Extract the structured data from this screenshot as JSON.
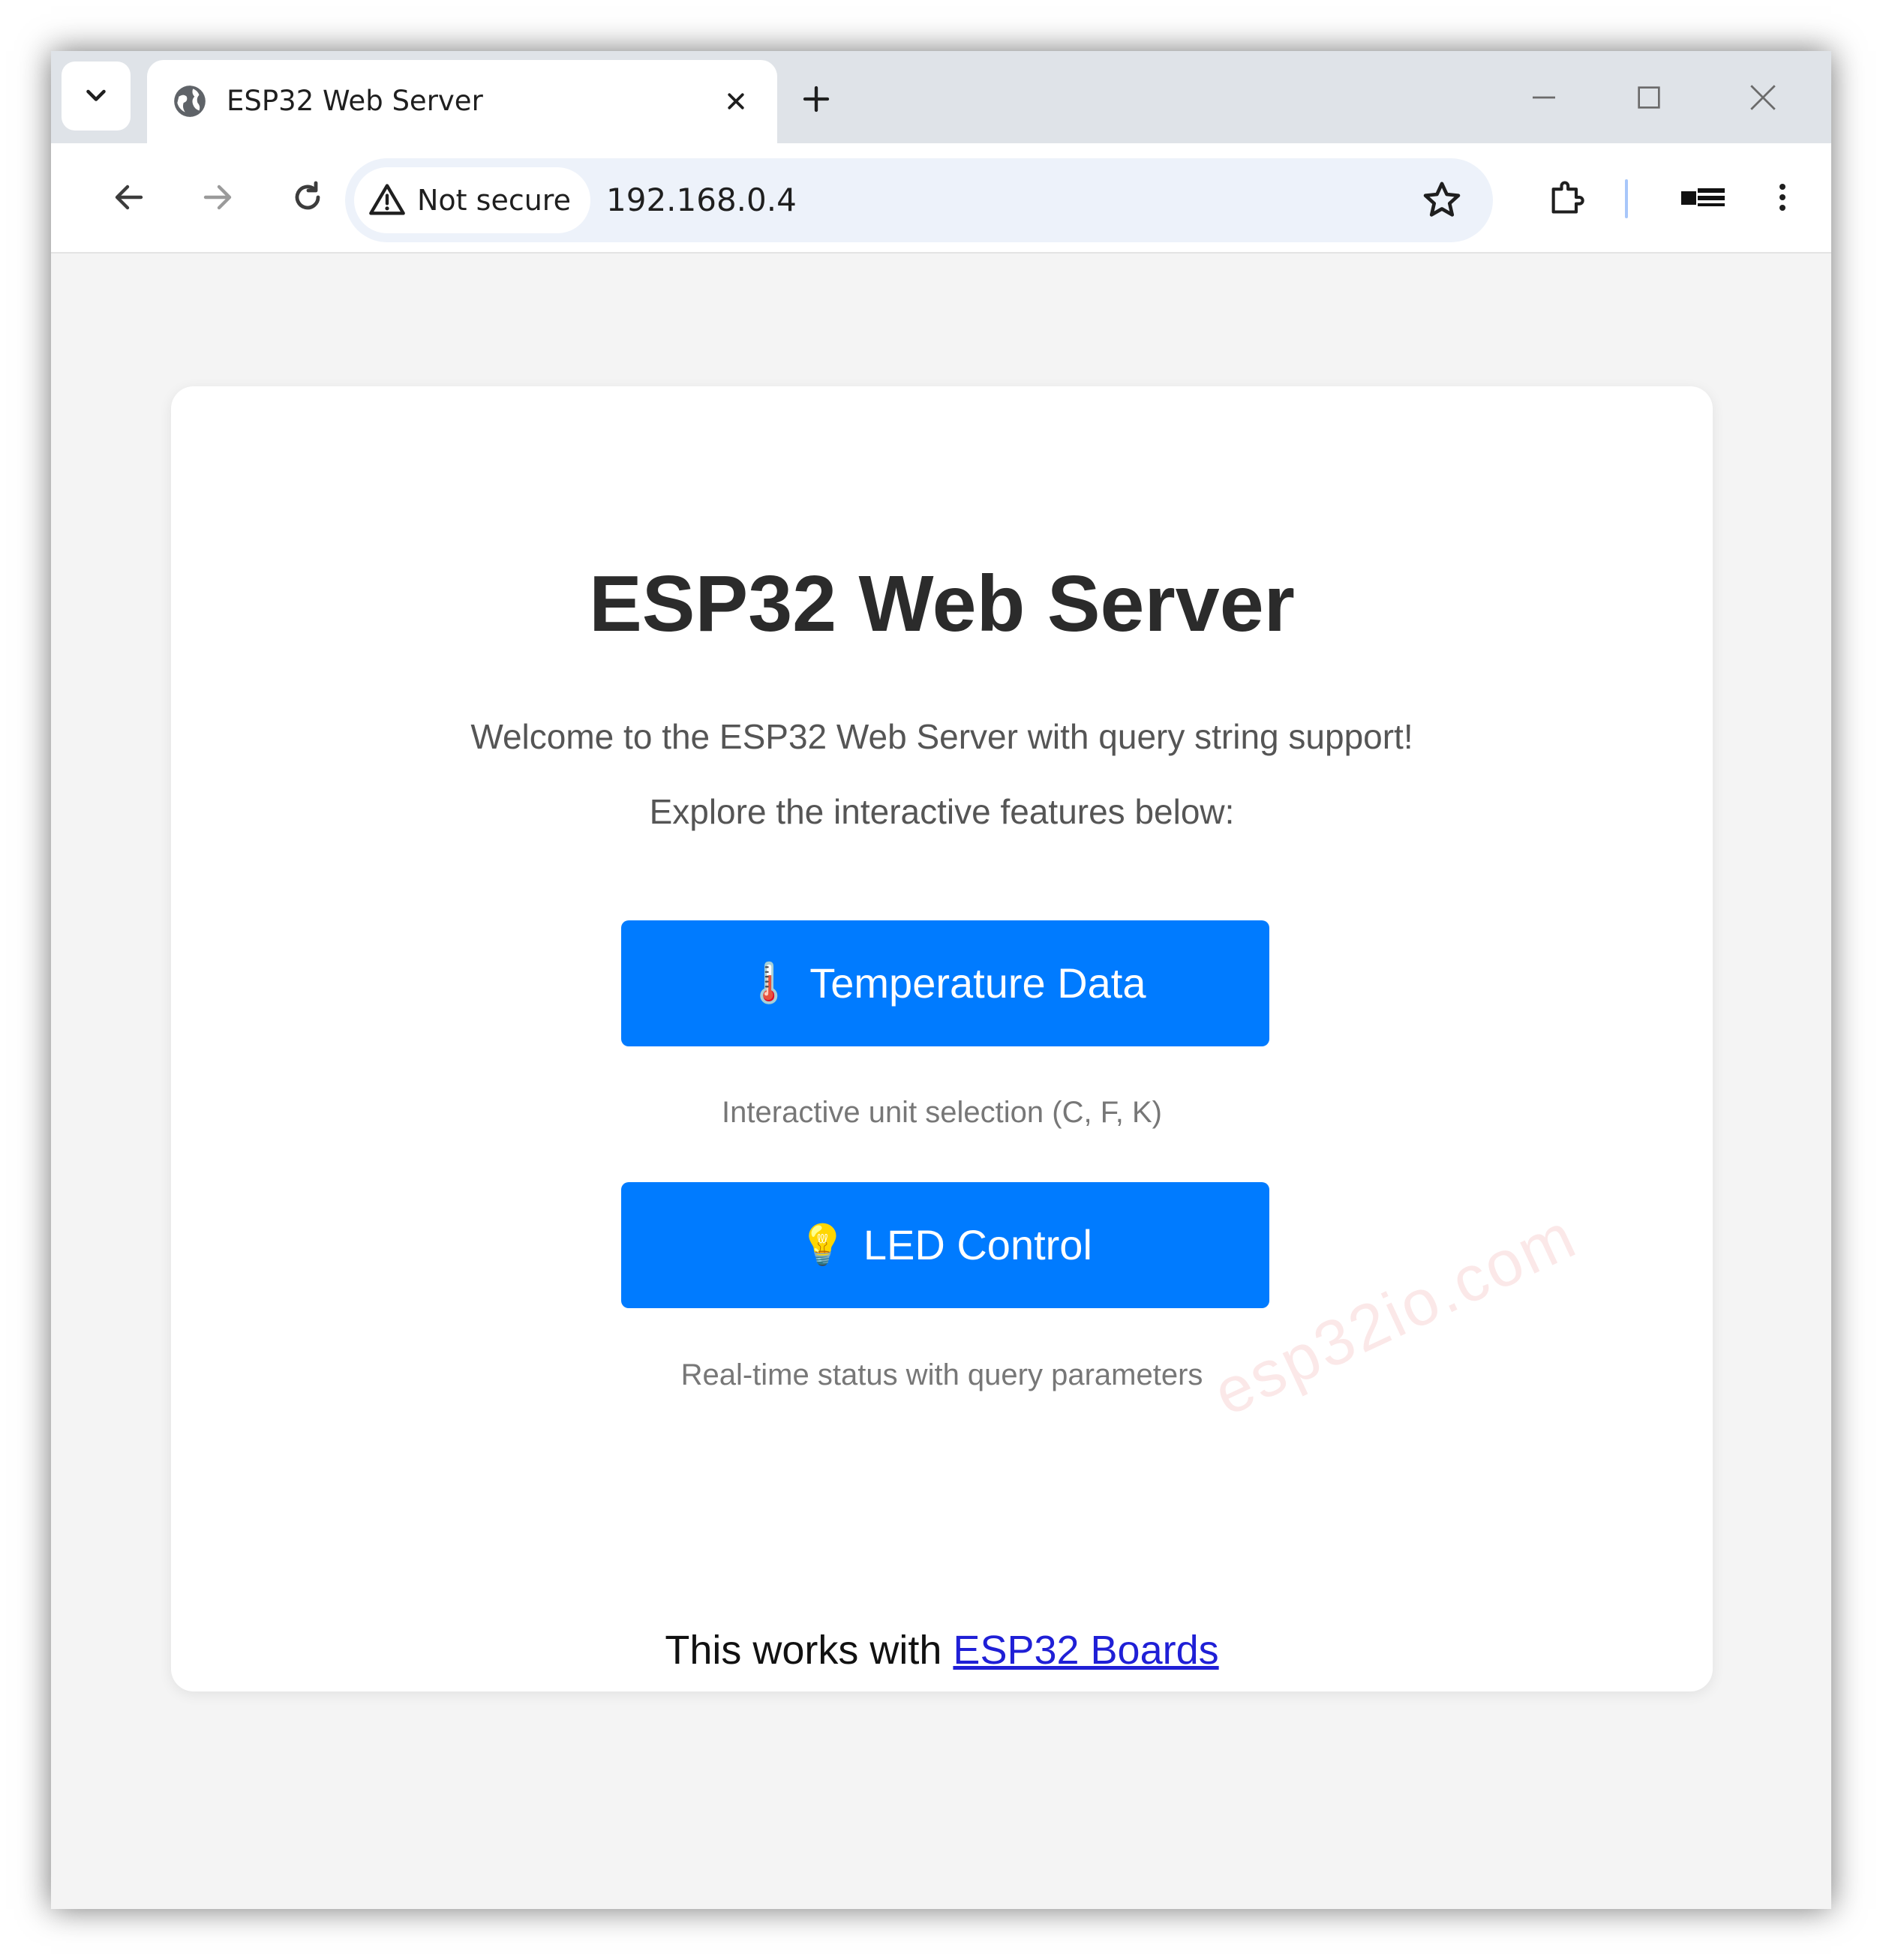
{
  "browser": {
    "tab": {
      "title": "ESP32 Web Server",
      "favicon_icon": "globe-icon",
      "close_icon": "close-icon"
    },
    "new_tab_icon": "plus-icon",
    "window_controls": [
      "minimize-icon",
      "maximize-icon",
      "close-icon"
    ],
    "nav": {
      "back_icon": "arrow-left-icon",
      "forward_icon": "arrow-right-icon",
      "reload_icon": "reload-icon"
    },
    "omnibox": {
      "security_label": "Not secure",
      "url": "192.168.0.4"
    },
    "toolbar_icons": [
      "star-icon",
      "extensions-icon",
      "profile-icon",
      "menu-icon"
    ]
  },
  "page": {
    "title": "ESP32 Web Server",
    "intro_line_1": "Welcome to the ESP32 Web Server with query string support!",
    "intro_line_2": "Explore the interactive features below:",
    "buttons": [
      {
        "emoji": "🌡️",
        "label": "Temperature Data",
        "hint": "Interactive unit selection (C, F, K)"
      },
      {
        "emoji": "💡",
        "label": "LED Control",
        "hint": "Real-time status with query parameters"
      }
    ],
    "footer_text": "This works with",
    "footer_link": "ESP32 Boards",
    "watermark": "esp32io.com"
  },
  "colors": {
    "button_bg": "#007bff",
    "button_text": "#ffffff",
    "link": "#1f1fd6",
    "tabstrip_bg": "#dfe3e8",
    "omnibox_bg": "#edf2fa",
    "page_bg": "#f4f4f4"
  }
}
